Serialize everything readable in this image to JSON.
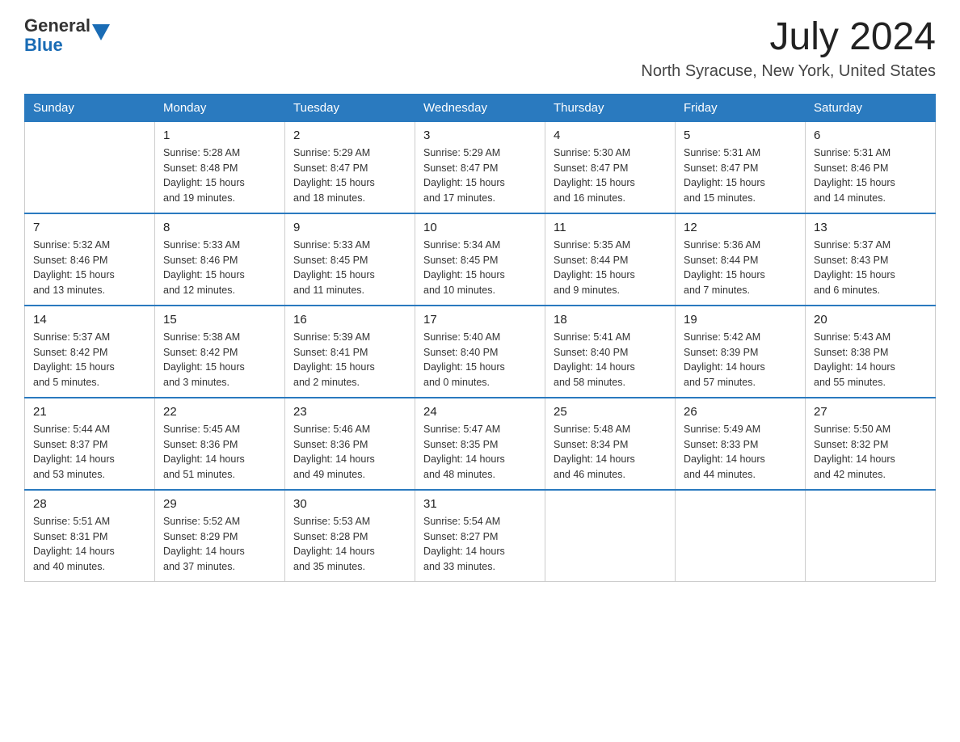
{
  "header": {
    "logo_general": "General",
    "logo_blue": "Blue",
    "month_year": "July 2024",
    "location": "North Syracuse, New York, United States"
  },
  "days_of_week": [
    "Sunday",
    "Monday",
    "Tuesday",
    "Wednesday",
    "Thursday",
    "Friday",
    "Saturday"
  ],
  "weeks": [
    [
      {
        "day": "",
        "info": ""
      },
      {
        "day": "1",
        "info": "Sunrise: 5:28 AM\nSunset: 8:48 PM\nDaylight: 15 hours\nand 19 minutes."
      },
      {
        "day": "2",
        "info": "Sunrise: 5:29 AM\nSunset: 8:47 PM\nDaylight: 15 hours\nand 18 minutes."
      },
      {
        "day": "3",
        "info": "Sunrise: 5:29 AM\nSunset: 8:47 PM\nDaylight: 15 hours\nand 17 minutes."
      },
      {
        "day": "4",
        "info": "Sunrise: 5:30 AM\nSunset: 8:47 PM\nDaylight: 15 hours\nand 16 minutes."
      },
      {
        "day": "5",
        "info": "Sunrise: 5:31 AM\nSunset: 8:47 PM\nDaylight: 15 hours\nand 15 minutes."
      },
      {
        "day": "6",
        "info": "Sunrise: 5:31 AM\nSunset: 8:46 PM\nDaylight: 15 hours\nand 14 minutes."
      }
    ],
    [
      {
        "day": "7",
        "info": "Sunrise: 5:32 AM\nSunset: 8:46 PM\nDaylight: 15 hours\nand 13 minutes."
      },
      {
        "day": "8",
        "info": "Sunrise: 5:33 AM\nSunset: 8:46 PM\nDaylight: 15 hours\nand 12 minutes."
      },
      {
        "day": "9",
        "info": "Sunrise: 5:33 AM\nSunset: 8:45 PM\nDaylight: 15 hours\nand 11 minutes."
      },
      {
        "day": "10",
        "info": "Sunrise: 5:34 AM\nSunset: 8:45 PM\nDaylight: 15 hours\nand 10 minutes."
      },
      {
        "day": "11",
        "info": "Sunrise: 5:35 AM\nSunset: 8:44 PM\nDaylight: 15 hours\nand 9 minutes."
      },
      {
        "day": "12",
        "info": "Sunrise: 5:36 AM\nSunset: 8:44 PM\nDaylight: 15 hours\nand 7 minutes."
      },
      {
        "day": "13",
        "info": "Sunrise: 5:37 AM\nSunset: 8:43 PM\nDaylight: 15 hours\nand 6 minutes."
      }
    ],
    [
      {
        "day": "14",
        "info": "Sunrise: 5:37 AM\nSunset: 8:42 PM\nDaylight: 15 hours\nand 5 minutes."
      },
      {
        "day": "15",
        "info": "Sunrise: 5:38 AM\nSunset: 8:42 PM\nDaylight: 15 hours\nand 3 minutes."
      },
      {
        "day": "16",
        "info": "Sunrise: 5:39 AM\nSunset: 8:41 PM\nDaylight: 15 hours\nand 2 minutes."
      },
      {
        "day": "17",
        "info": "Sunrise: 5:40 AM\nSunset: 8:40 PM\nDaylight: 15 hours\nand 0 minutes."
      },
      {
        "day": "18",
        "info": "Sunrise: 5:41 AM\nSunset: 8:40 PM\nDaylight: 14 hours\nand 58 minutes."
      },
      {
        "day": "19",
        "info": "Sunrise: 5:42 AM\nSunset: 8:39 PM\nDaylight: 14 hours\nand 57 minutes."
      },
      {
        "day": "20",
        "info": "Sunrise: 5:43 AM\nSunset: 8:38 PM\nDaylight: 14 hours\nand 55 minutes."
      }
    ],
    [
      {
        "day": "21",
        "info": "Sunrise: 5:44 AM\nSunset: 8:37 PM\nDaylight: 14 hours\nand 53 minutes."
      },
      {
        "day": "22",
        "info": "Sunrise: 5:45 AM\nSunset: 8:36 PM\nDaylight: 14 hours\nand 51 minutes."
      },
      {
        "day": "23",
        "info": "Sunrise: 5:46 AM\nSunset: 8:36 PM\nDaylight: 14 hours\nand 49 minutes."
      },
      {
        "day": "24",
        "info": "Sunrise: 5:47 AM\nSunset: 8:35 PM\nDaylight: 14 hours\nand 48 minutes."
      },
      {
        "day": "25",
        "info": "Sunrise: 5:48 AM\nSunset: 8:34 PM\nDaylight: 14 hours\nand 46 minutes."
      },
      {
        "day": "26",
        "info": "Sunrise: 5:49 AM\nSunset: 8:33 PM\nDaylight: 14 hours\nand 44 minutes."
      },
      {
        "day": "27",
        "info": "Sunrise: 5:50 AM\nSunset: 8:32 PM\nDaylight: 14 hours\nand 42 minutes."
      }
    ],
    [
      {
        "day": "28",
        "info": "Sunrise: 5:51 AM\nSunset: 8:31 PM\nDaylight: 14 hours\nand 40 minutes."
      },
      {
        "day": "29",
        "info": "Sunrise: 5:52 AM\nSunset: 8:29 PM\nDaylight: 14 hours\nand 37 minutes."
      },
      {
        "day": "30",
        "info": "Sunrise: 5:53 AM\nSunset: 8:28 PM\nDaylight: 14 hours\nand 35 minutes."
      },
      {
        "day": "31",
        "info": "Sunrise: 5:54 AM\nSunset: 8:27 PM\nDaylight: 14 hours\nand 33 minutes."
      },
      {
        "day": "",
        "info": ""
      },
      {
        "day": "",
        "info": ""
      },
      {
        "day": "",
        "info": ""
      }
    ]
  ]
}
